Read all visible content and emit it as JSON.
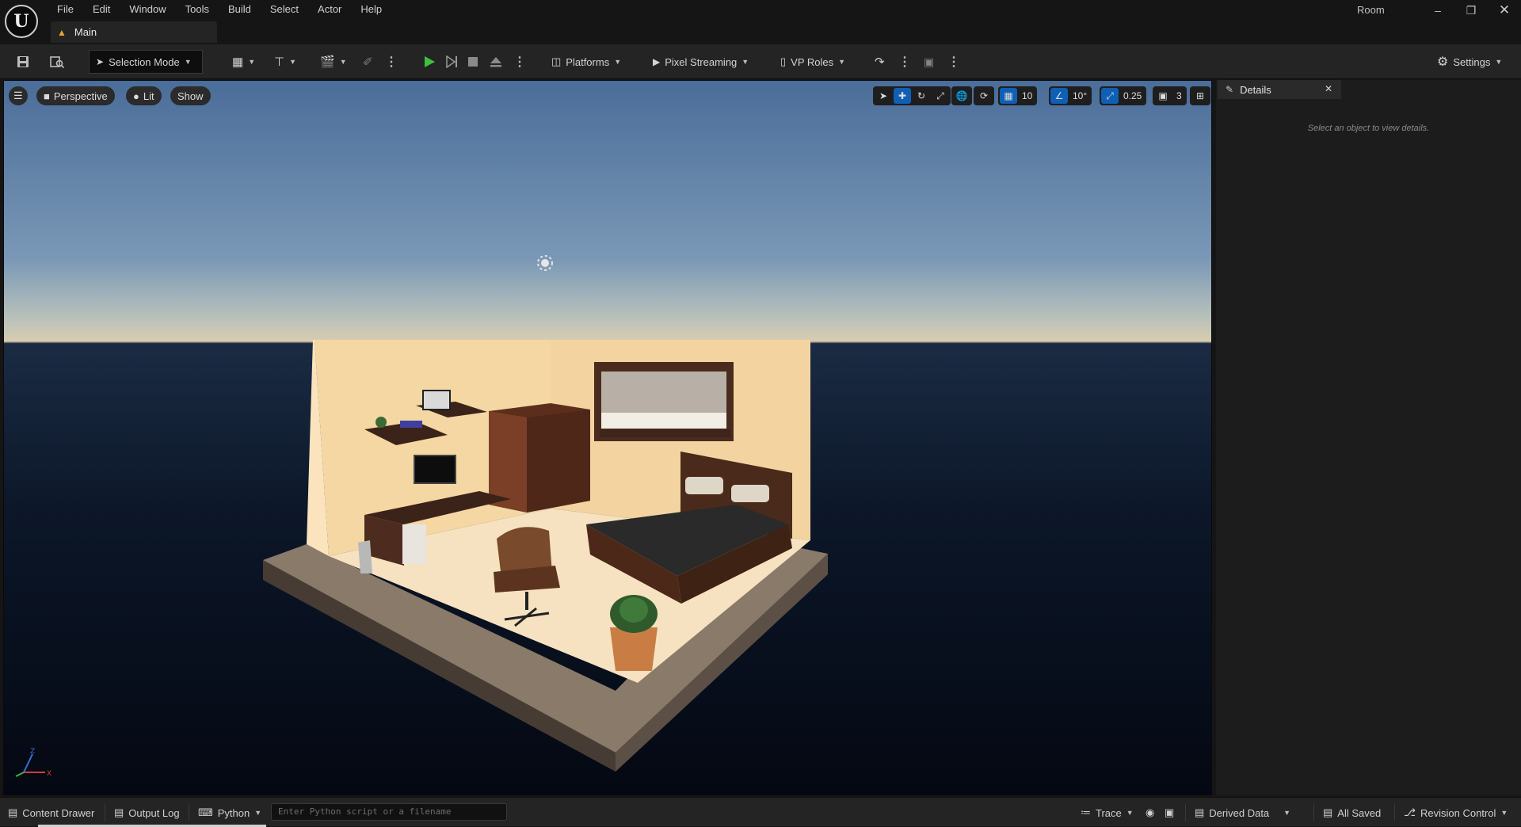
{
  "menu": [
    "File",
    "Edit",
    "Window",
    "Tools",
    "Build",
    "Select",
    "Actor",
    "Help"
  ],
  "tab": {
    "label": "Main"
  },
  "project": {
    "name": "Room"
  },
  "toolbar": {
    "selection_mode": "Selection Mode",
    "platforms": "Platforms",
    "pixel_streaming": "Pixel Streaming",
    "vp_roles": "VP Roles",
    "settings": "Settings"
  },
  "viewport": {
    "perspective": "Perspective",
    "lit": "Lit",
    "show": "Show",
    "grid_snap": "10",
    "rotation_snap": "10°",
    "scale_snap": "0.25",
    "camera_speed": "3"
  },
  "details": {
    "title": "Details",
    "empty_message": "Select an object to view details."
  },
  "statusbar": {
    "content_drawer": "Content Drawer",
    "output_log": "Output Log",
    "python": "Python",
    "python_placeholder": "Enter Python script or a filename",
    "trace": "Trace",
    "derived_data": "Derived Data",
    "all_saved": "All Saved",
    "revision_control": "Revision Control"
  },
  "colors": {
    "play_green": "#3fbf3f",
    "accent_blue": "#0f5fb5"
  }
}
